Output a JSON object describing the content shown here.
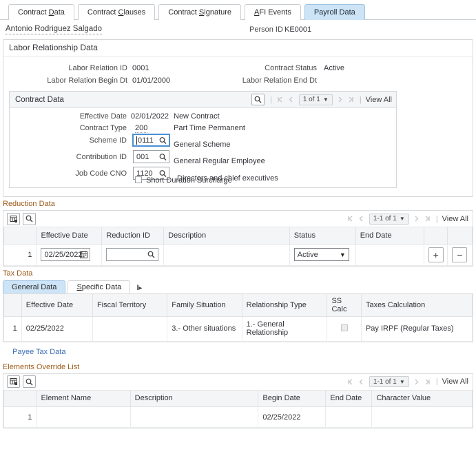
{
  "tabs": [
    {
      "label": "Contract Data",
      "accel": "D",
      "active": false
    },
    {
      "label": "Contract Clauses",
      "accel": "C",
      "active": false
    },
    {
      "label": "Contract Signature",
      "accel": "S",
      "active": false
    },
    {
      "label": "AFI Events",
      "accel": "A",
      "active": false
    },
    {
      "label": "Payroll Data",
      "accel": "",
      "active": true
    }
  ],
  "person": {
    "name": "Antonio Rodriguez Salgado",
    "id_label": "Person ID",
    "id_value": "KE0001"
  },
  "labor_relationship": {
    "title": "Labor Relationship Data",
    "fields": [
      {
        "label": "Labor Relation ID",
        "value": "0001"
      },
      {
        "label": "Contract Status",
        "value": "Active"
      },
      {
        "label": "Labor Relation Begin Dt",
        "value": "01/01/2000"
      },
      {
        "label": "Labor Relation End Dt",
        "value": ""
      }
    ]
  },
  "contract_data": {
    "title": "Contract Data",
    "nav": {
      "search_icon": "magnifier-icon",
      "first_icon": "first-page-icon",
      "prev_icon": "previous-page-icon",
      "pager_text": "1 of 1",
      "next_icon": "next-page-icon",
      "last_icon": "last-page-icon",
      "view_all": "View All"
    },
    "effective_date_label": "Effective Date",
    "effective_date_value": "02/01/2022",
    "effective_date_desc": "New Contract",
    "contract_type_label": "Contract Type",
    "contract_type_value": "200",
    "contract_type_desc": "Part Time Permanent",
    "scheme_id_label": "Scheme ID",
    "scheme_id_value": "0111",
    "scheme_id_desc": "General Scheme",
    "contribution_id_label": "Contribution ID",
    "contribution_id_value": "001",
    "contribution_id_desc": "General Regular Employee",
    "job_code_label": "Job Code CNO",
    "job_code_value": "1120",
    "job_code_desc": "Directors and chief executives",
    "short_duration_label": "Short Duration Surcharge",
    "short_duration_checked": false
  },
  "reduction_data": {
    "title": "Reduction Data",
    "toolbar": {
      "personalize_icon": "grid-personalize-icon",
      "find_icon": "magnifier-icon",
      "first_icon": "first-page-icon",
      "prev_icon": "previous-page-icon",
      "pager_text": "1-1 of 1",
      "next_icon": "next-page-icon",
      "last_icon": "last-page-icon",
      "view_all": "View All"
    },
    "columns": [
      "",
      "Effective Date",
      "Reduction ID",
      "Description",
      "Status",
      "End Date",
      "",
      ""
    ],
    "rows": [
      {
        "num": "1",
        "effective_date": "02/25/2022",
        "reduction_id": "",
        "description": "",
        "status": "Active",
        "end_date": "",
        "add_label": "+",
        "remove_label": "−"
      }
    ]
  },
  "tax_data": {
    "title": "Tax Data",
    "subtabs": [
      {
        "label": "General Data",
        "accel": "",
        "active": true
      },
      {
        "label": "Specific Data",
        "accel": "S",
        "active": false
      }
    ],
    "expand_icon": "expand-sections-icon",
    "columns": [
      "",
      "Effective Date",
      "Fiscal Territory",
      "Family Situation",
      "Relationship Type",
      "SS Calc",
      "Taxes Calculation"
    ],
    "rows": [
      {
        "num": "1",
        "effective_date": "02/25/2022",
        "fiscal_territory": "",
        "family_situation": "3.- Other situations",
        "relationship_type": "1.- General Relationship",
        "ss_calc_checked": true,
        "taxes_calculation": "Pay IRPF (Regular Taxes)"
      }
    ],
    "payee_link": "Payee Tax Data"
  },
  "elements_override": {
    "title": "Elements Override List",
    "toolbar": {
      "personalize_icon": "grid-personalize-icon",
      "find_icon": "magnifier-icon",
      "first_icon": "first-page-icon",
      "prev_icon": "previous-page-icon",
      "pager_text": "1-1 of 1",
      "next_icon": "next-page-icon",
      "last_icon": "last-page-icon",
      "view_all": "View All"
    },
    "columns": [
      "",
      "Element Name",
      "Description",
      "Begin Date",
      "End Date",
      "Character Value"
    ],
    "rows": [
      {
        "num": "1",
        "element_name": "",
        "description": "",
        "begin_date": "02/25/2022",
        "end_date": "",
        "character_value": ""
      }
    ]
  },
  "colors": {
    "active_tab": "#cde4f7",
    "section_label": "#9c5a19",
    "link": "#3c6eb4",
    "header_bg": "#f4f5f6"
  }
}
